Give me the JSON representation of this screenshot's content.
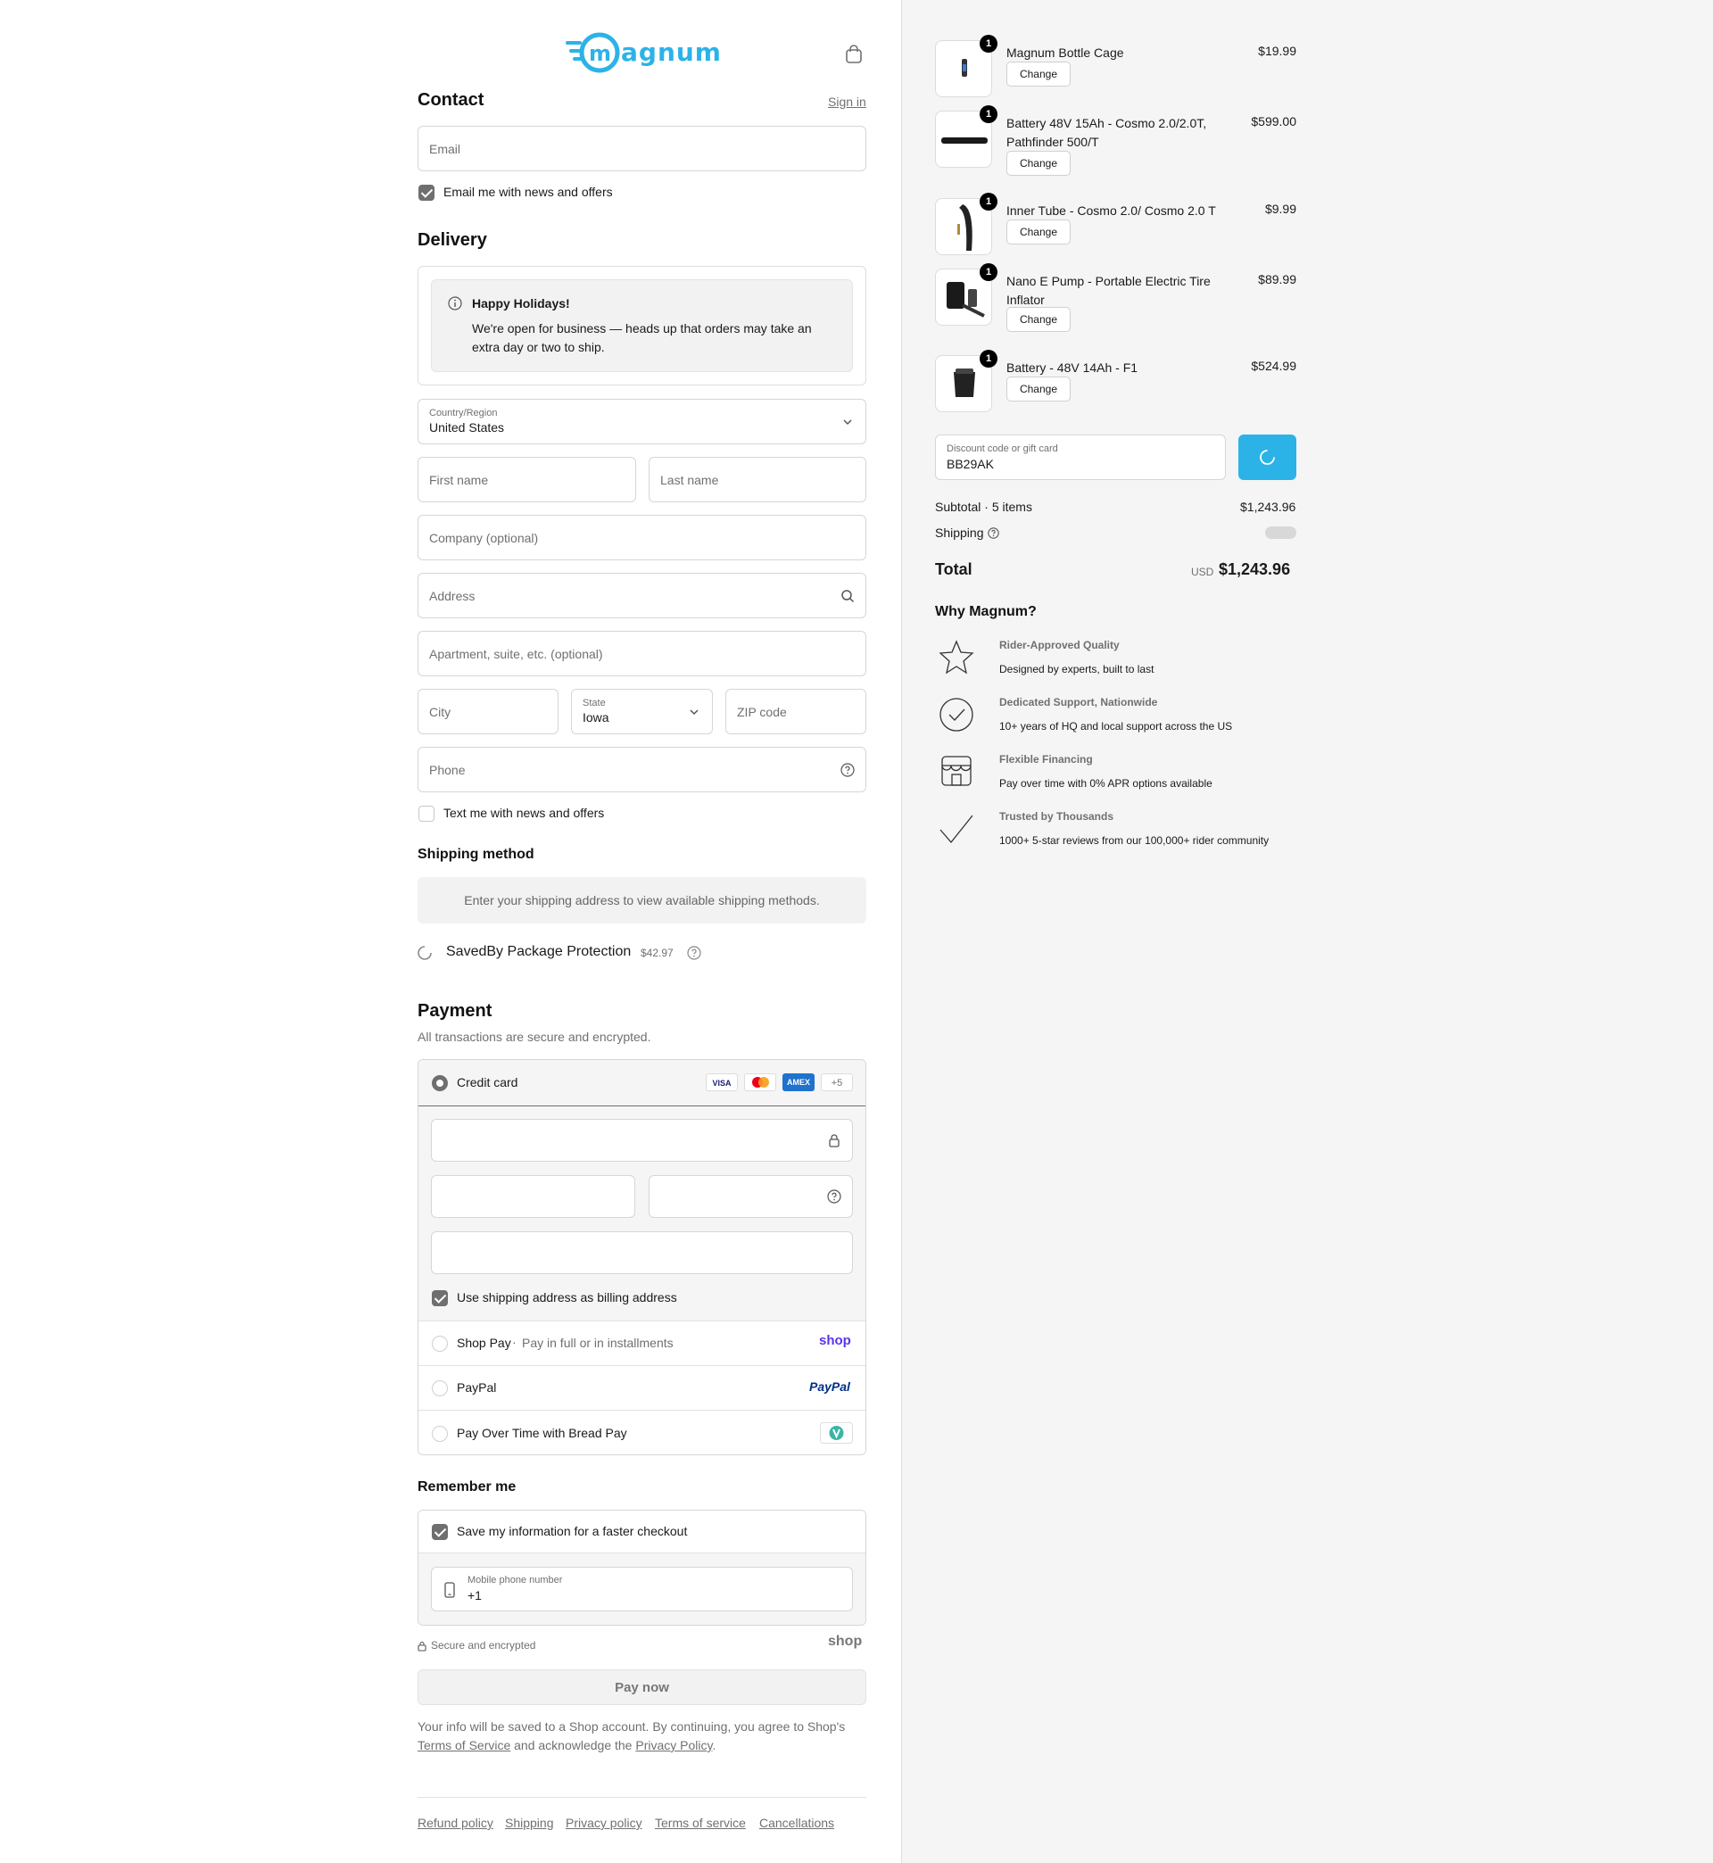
{
  "brand": {
    "name": "magnum",
    "color": "#2bb3e8"
  },
  "contact": {
    "title": "Contact",
    "sign_in": "Sign in",
    "email_placeholder": "Email",
    "news_label": "Email me with news and offers",
    "news_checked": true
  },
  "delivery": {
    "title": "Delivery",
    "notice_title": "Happy Holidays!",
    "notice_line1": "We're open for business — heads up that orders may take an",
    "notice_line2": "extra day or two to ship.",
    "country_label": "Country/Region",
    "country_value": "United States",
    "first_name": "First name",
    "last_name": "Last name",
    "company": "Company (optional)",
    "address": "Address",
    "apartment": "Apartment, suite, etc. (optional)",
    "city": "City",
    "state_label": "State",
    "state_value": "Iowa",
    "zip": "ZIP code",
    "phone": "Phone",
    "text_label": "Text me with news and offers",
    "text_checked": false
  },
  "shipping_method": {
    "title": "Shipping method",
    "message": "Enter your shipping address to view available shipping methods.",
    "protection_label": "SavedBy Package Protection",
    "protection_price": "$42.97"
  },
  "payment": {
    "title": "Payment",
    "subtitle": "All transactions are secure and encrypted.",
    "credit_card": "Credit card",
    "card_logos": [
      "VISA",
      "MC",
      "AMEX",
      "+5"
    ],
    "billing_label": "Use shipping address as billing address",
    "shop_pay": "Shop Pay",
    "shop_pay_sub": "Pay in full or in installments",
    "shop_logo": "shop",
    "paypal": "PayPal",
    "paypal_logo": "PayPal",
    "bread": "Pay Over Time with Bread Pay"
  },
  "remember": {
    "title": "Remember me",
    "save_label": "Save my information for a faster checkout",
    "mobile_label": "Mobile phone number",
    "mobile_value": "+1",
    "secure": "Secure and encrypted",
    "shop_logo": "shop"
  },
  "pay_now": "Pay now",
  "legal": {
    "line1": "Your info will be saved to a Shop account. By continuing, you agree to Shop's",
    "terms": "Terms of Service",
    "and": " and acknowledge the ",
    "privacy": "Privacy Policy",
    "end": "."
  },
  "footer_links": [
    "Refund policy",
    "Shipping",
    "Privacy policy",
    "Terms of service",
    "Cancellations"
  ],
  "cart": {
    "items": [
      {
        "name": "Magnum Bottle Cage",
        "price": "$19.99",
        "qty": "1",
        "change": "Change"
      },
      {
        "name": "Battery 48V 15Ah - Cosmo 2.0/2.0T, Pathfinder 500/T",
        "price": "$599.00",
        "qty": "1",
        "change": "Change"
      },
      {
        "name": "Inner Tube - Cosmo 2.0/ Cosmo 2.0 T",
        "price": "$9.99",
        "qty": "1",
        "change": "Change"
      },
      {
        "name": "Nano E Pump - Portable Electric Tire Inflator",
        "price": "$89.99",
        "qty": "1",
        "change": "Change"
      },
      {
        "name": "Battery - 48V 14Ah - F1",
        "price": "$524.99",
        "qty": "1",
        "change": "Change"
      }
    ],
    "discount_label": "Discount code or gift card",
    "discount_value": "BB29AK",
    "subtotal_label": "Subtotal · 5 items",
    "subtotal_value": "$1,243.96",
    "shipping_label": "Shipping",
    "total_label": "Total",
    "currency": "USD",
    "total_value": "$1,243.96"
  },
  "why": {
    "title": "Why Magnum?",
    "items": [
      {
        "title": "Rider-Approved Quality",
        "desc": "Designed by experts, built to last",
        "icon": "star-icon"
      },
      {
        "title": "Dedicated Support, Nationwide",
        "desc": "10+ years of HQ and local support across the US",
        "icon": "check-circle-icon"
      },
      {
        "title": "Flexible Financing",
        "desc": "Pay over time with 0% APR options available",
        "icon": "store-icon"
      },
      {
        "title": "Trusted by Thousands",
        "desc": "1000+ 5-star reviews from our 100,000+ rider community",
        "icon": "check-icon"
      }
    ]
  }
}
